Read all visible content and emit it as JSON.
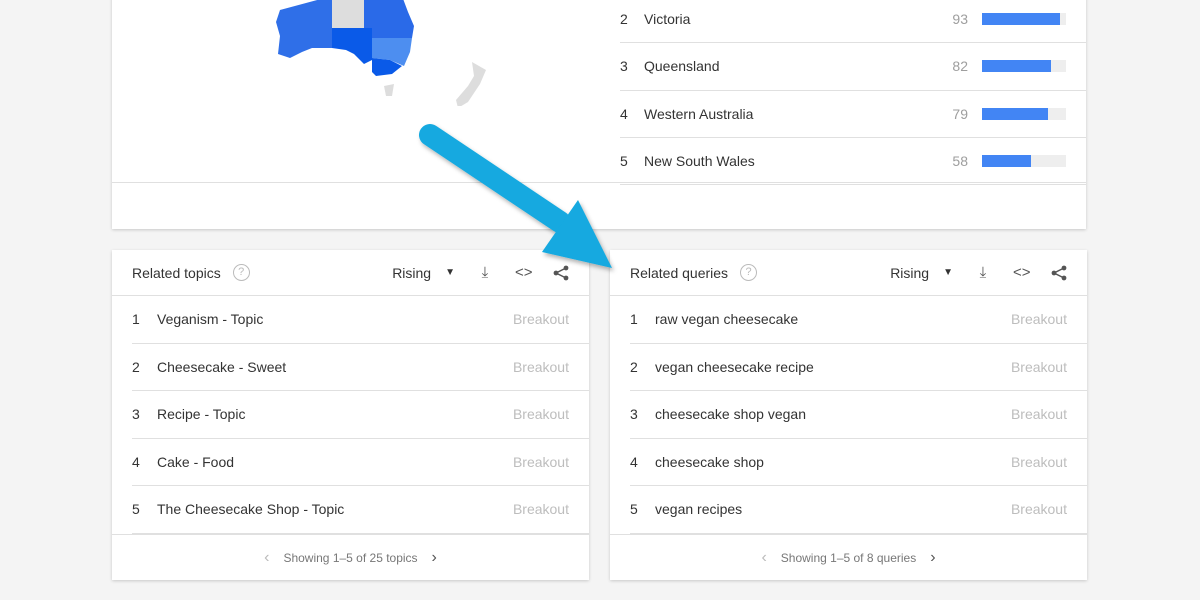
{
  "map_colors": {
    "high": "#1a73e8",
    "mid": "#2f6fe8",
    "light": "#4d8ef0",
    "none": "#dddddd"
  },
  "regions": [
    {
      "rank": "2",
      "name": "Victoria",
      "value": "93",
      "fill": 0.93
    },
    {
      "rank": "3",
      "name": "Queensland",
      "value": "82",
      "fill": 0.82
    },
    {
      "rank": "4",
      "name": "Western Australia",
      "value": "79",
      "fill": 0.79
    },
    {
      "rank": "5",
      "name": "New South Wales",
      "value": "58",
      "fill": 0.58
    }
  ],
  "related_topics": {
    "title": "Related topics",
    "help": "?",
    "filter": "Rising",
    "rows": [
      {
        "rank": "1",
        "label": "Veganism - Topic",
        "value": "Breakout"
      },
      {
        "rank": "2",
        "label": "Cheesecake - Sweet",
        "value": "Breakout"
      },
      {
        "rank": "3",
        "label": "Recipe - Topic",
        "value": "Breakout"
      },
      {
        "rank": "4",
        "label": "Cake - Food",
        "value": "Breakout"
      },
      {
        "rank": "5",
        "label": "The Cheesecake Shop - Topic",
        "value": "Breakout"
      }
    ],
    "pagination": "Showing 1–5 of 25 topics"
  },
  "related_queries": {
    "title": "Related queries",
    "help": "?",
    "filter": "Rising",
    "rows": [
      {
        "rank": "1",
        "label": "raw vegan cheesecake",
        "value": "Breakout"
      },
      {
        "rank": "2",
        "label": "vegan cheesecake recipe",
        "value": "Breakout"
      },
      {
        "rank": "3",
        "label": "cheesecake shop vegan",
        "value": "Breakout"
      },
      {
        "rank": "4",
        "label": "cheesecake shop",
        "value": "Breakout"
      },
      {
        "rank": "5",
        "label": "vegan recipes",
        "value": "Breakout"
      }
    ],
    "pagination": "Showing 1–5 of 8 queries"
  },
  "icons": {
    "caret": "▼",
    "download": "⤓",
    "embed": "<>",
    "share": "share-icon",
    "prev": "‹",
    "next": "›"
  },
  "annotation_arrow_color": "#12a9e0"
}
